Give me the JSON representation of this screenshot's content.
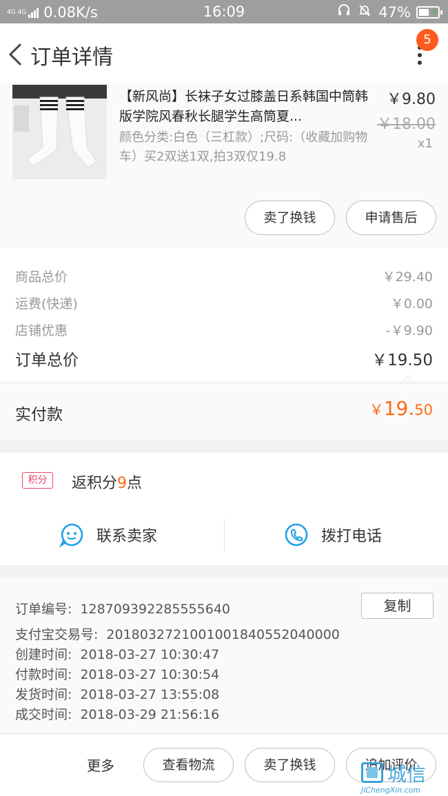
{
  "status_bar": {
    "network_mini": "4G 4G",
    "speed": "0.08K/s",
    "time": "16:09",
    "battery": "47%"
  },
  "header": {
    "title": "订单详情",
    "badge_count": "5"
  },
  "product": {
    "title": "【新风尚】长袜子女过膝盖日系韩国中筒韩版学院风春秋长腿学生高筒夏...",
    "sku": "颜色分类:白色（三杠款）;尺码:（收藏加购物车）买2双送1双,拍3双仅19.8",
    "price": "￥9.80",
    "original_price": "￥18.00",
    "quantity": "x1",
    "actions": {
      "resell": "卖了换钱",
      "after_sale": "申请售后"
    }
  },
  "summary": {
    "rows": [
      {
        "label": "商品总价",
        "value": "￥29.40"
      },
      {
        "label": "运费(快递)",
        "value": "￥0.00"
      },
      {
        "label": "店铺优惠",
        "value": "-￥9.90"
      }
    ],
    "total_label": "订单总价",
    "total_value": "￥19.50",
    "paid_label": "实付款",
    "paid_currency": "￥",
    "paid_int": "19.",
    "paid_dec": "50"
  },
  "points": {
    "tag": "积分",
    "prefix": "返积分",
    "value": "9",
    "suffix": "点"
  },
  "contact": {
    "seller": "联系卖家",
    "phone": "拨打电话"
  },
  "order_info": {
    "copy_label": "复制",
    "rows": [
      {
        "label": "订单编号:",
        "value": "128709392285555640"
      },
      {
        "label": "支付宝交易号:",
        "value": "2018032721001001840552040000"
      },
      {
        "label": "创建时间:",
        "value": "2018-03-27 10:30:47"
      },
      {
        "label": "付款时间:",
        "value": "2018-03-27 10:30:54"
      },
      {
        "label": "发货时间:",
        "value": "2018-03-27 13:55:08"
      },
      {
        "label": "成交时间:",
        "value": "2018-03-29 21:56:16"
      }
    ]
  },
  "bottom_bar": {
    "more": "更多",
    "logistics": "查看物流",
    "resell": "卖了换钱",
    "review": "追加评价"
  },
  "watermark": {
    "cn": "城信",
    "en": "JiChengXin.com"
  },
  "colors": {
    "accent_orange": "#ff6a13",
    "badge": "#ff5a1f",
    "points_tag": "#e8456b",
    "icon_blue": "#1ea1e6"
  }
}
